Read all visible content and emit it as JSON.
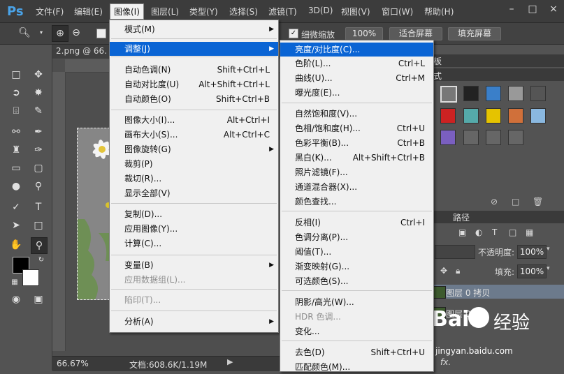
{
  "app_logo": "Ps",
  "menubar": [
    "文件(F)",
    "编辑(E)",
    "图像(I)",
    "图层(L)",
    "类型(Y)",
    "选择(S)",
    "滤镜(T)",
    "3D(D)",
    "视图(V)",
    "窗口(W)",
    "帮助(H)"
  ],
  "window_controls": [
    "–",
    "□",
    "×"
  ],
  "options": {
    "fine_zoom_label": "细微缩放",
    "zoom_value": "100%",
    "fit_screen": "适合屏幕",
    "fill_screen": "填充屏幕"
  },
  "doc_tab": "2.png @ 66.",
  "status": {
    "zoom": "66.67%",
    "doc_info": "文档:608.6K/1.19M"
  },
  "image_menu": [
    {
      "label": "模式(M)",
      "shortcut": "",
      "submenu": true
    },
    {
      "sep": true
    },
    {
      "label": "调整(J)",
      "shortcut": "",
      "submenu": true,
      "highlight": true
    },
    {
      "sep": true
    },
    {
      "label": "自动色调(N)",
      "shortcut": "Shift+Ctrl+L"
    },
    {
      "label": "自动对比度(U)",
      "shortcut": "Alt+Shift+Ctrl+L"
    },
    {
      "label": "自动颜色(O)",
      "shortcut": "Shift+Ctrl+B"
    },
    {
      "sep": true
    },
    {
      "label": "图像大小(I)...",
      "shortcut": "Alt+Ctrl+I"
    },
    {
      "label": "画布大小(S)...",
      "shortcut": "Alt+Ctrl+C"
    },
    {
      "label": "图像旋转(G)",
      "shortcut": "",
      "submenu": true
    },
    {
      "label": "裁剪(P)",
      "shortcut": ""
    },
    {
      "label": "裁切(R)...",
      "shortcut": ""
    },
    {
      "label": "显示全部(V)",
      "shortcut": ""
    },
    {
      "sep": true
    },
    {
      "label": "复制(D)...",
      "shortcut": ""
    },
    {
      "label": "应用图像(Y)...",
      "shortcut": ""
    },
    {
      "label": "计算(C)...",
      "shortcut": ""
    },
    {
      "sep": true
    },
    {
      "label": "变量(B)",
      "shortcut": "",
      "submenu": true
    },
    {
      "label": "应用数据组(L)...",
      "shortcut": "",
      "disabled": true
    },
    {
      "sep": true
    },
    {
      "label": "陷印(T)...",
      "shortcut": "",
      "disabled": true
    },
    {
      "sep": true
    },
    {
      "label": "分析(A)",
      "shortcut": "",
      "submenu": true
    }
  ],
  "adjust_menu": [
    {
      "label": "亮度/对比度(C)...",
      "shortcut": "",
      "highlight": true
    },
    {
      "label": "色阶(L)...",
      "shortcut": "Ctrl+L"
    },
    {
      "label": "曲线(U)...",
      "shortcut": "Ctrl+M"
    },
    {
      "label": "曝光度(E)...",
      "shortcut": ""
    },
    {
      "sep": true
    },
    {
      "label": "自然饱和度(V)...",
      "shortcut": ""
    },
    {
      "label": "色相/饱和度(H)...",
      "shortcut": "Ctrl+U"
    },
    {
      "label": "色彩平衡(B)...",
      "shortcut": "Ctrl+B"
    },
    {
      "label": "黑白(K)...",
      "shortcut": "Alt+Shift+Ctrl+B"
    },
    {
      "label": "照片滤镜(F)...",
      "shortcut": ""
    },
    {
      "label": "通道混合器(X)...",
      "shortcut": ""
    },
    {
      "label": "颜色查找...",
      "shortcut": ""
    },
    {
      "sep": true
    },
    {
      "label": "反相(I)",
      "shortcut": "Ctrl+I"
    },
    {
      "label": "色调分离(P)...",
      "shortcut": ""
    },
    {
      "label": "阈值(T)...",
      "shortcut": ""
    },
    {
      "label": "渐变映射(G)...",
      "shortcut": ""
    },
    {
      "label": "可选颜色(S)...",
      "shortcut": ""
    },
    {
      "sep": true
    },
    {
      "label": "阴影/高光(W)...",
      "shortcut": ""
    },
    {
      "label": "HDR 色调...",
      "shortcut": "",
      "disabled": true
    },
    {
      "label": "变化...",
      "shortcut": ""
    },
    {
      "sep": true
    },
    {
      "label": "去色(D)",
      "shortcut": "Shift+Ctrl+U"
    },
    {
      "label": "匹配颜色(M)...",
      "shortcut": ""
    }
  ],
  "panels": {
    "tab_fragment_top": "板",
    "tab_fragment_styles": "式",
    "tab_paths": "路径",
    "opacity_label": "不透明度:",
    "opacity_value": "100%",
    "fill_label": "填充:",
    "fill_value": "100%",
    "layers": [
      "图层 0 拷贝",
      "图层 0"
    ],
    "fx_label": "fx."
  },
  "watermark": {
    "brand": "Bai",
    "brand_cn": "经验",
    "url": "jingyan.baidu.com"
  },
  "colors": {
    "highlight": "#0a64d4",
    "menu_bg": "#f0f0f0",
    "ps_blue": "#4aa3e8"
  }
}
